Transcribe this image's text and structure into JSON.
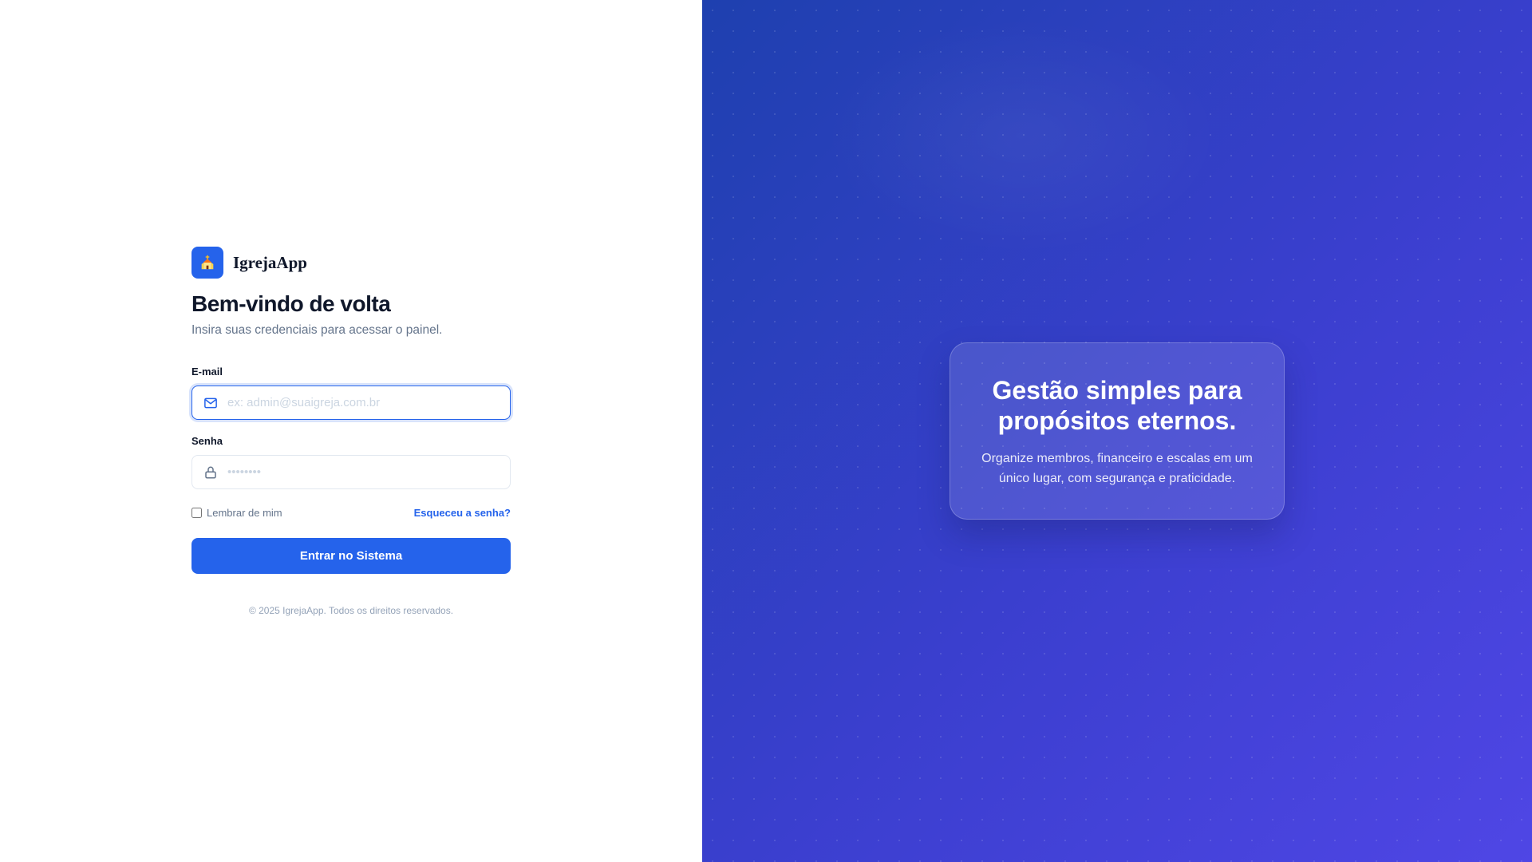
{
  "brand": {
    "name": "IgrejaApp",
    "logo_icon": "church-icon",
    "accent_color": "#2563eb"
  },
  "login": {
    "heading": "Bem-vindo de volta",
    "subheading": "Insira suas credenciais para acessar o painel.",
    "email": {
      "label": "E-mail",
      "placeholder": "ex: admin@suaigreja.com.br",
      "value": "",
      "icon": "mail-icon"
    },
    "password": {
      "label": "Senha",
      "placeholder": "••••••••",
      "value": "",
      "icon": "lock-icon"
    },
    "remember_label": "Lembrar de mim",
    "remember_checked": false,
    "forgot_label": "Esqueceu a senha?",
    "submit_label": "Entrar no Sistema",
    "footer": "© 2025 IgrejaApp. Todos os direitos reservados."
  },
  "promo": {
    "title": "Gestão simples para propósitos eternos.",
    "text": "Organize membros, financeiro e escalas em um único lugar, com segurança e praticidade.",
    "gradient_start": "#1e40af",
    "gradient_end": "#4f46e5"
  }
}
